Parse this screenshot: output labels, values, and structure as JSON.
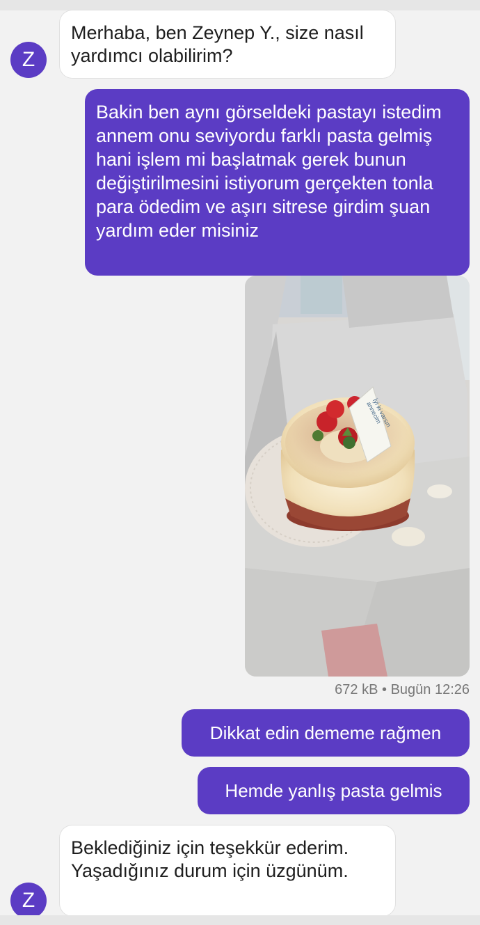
{
  "contact": {
    "initial": "Z"
  },
  "messages": {
    "greeting": "Merhaba, ben Zeynep Y., size nasıl yardımcı olabilirim?",
    "complaint": "Bakin ben aynı görseldeki pastayı istedim annem onu seviyordu farklı pasta gelmiş hani işlem mi başlatmak gerek bunun değiştirilmesini istiyorum gerçekten tonla para ödedim ve aşırı sitrese girdim şuan yardım eder misiniz",
    "attention": "Dikkat edin dememe rağmen",
    "wrong_cake": "Hemde yanlış pasta gelmis",
    "reply": "Beklediğiniz için teşekkür ederim. Yaşadığınız durum için üzgünüm."
  },
  "attachment": {
    "size": "672 kB",
    "separator": "•",
    "time": "Bugün 12:26",
    "card_text": "İyi ki varsın annecim"
  },
  "colors": {
    "accent": "#5b3cc4",
    "incoming_bubble": "#ffffff",
    "background": "#f2f2f2"
  }
}
